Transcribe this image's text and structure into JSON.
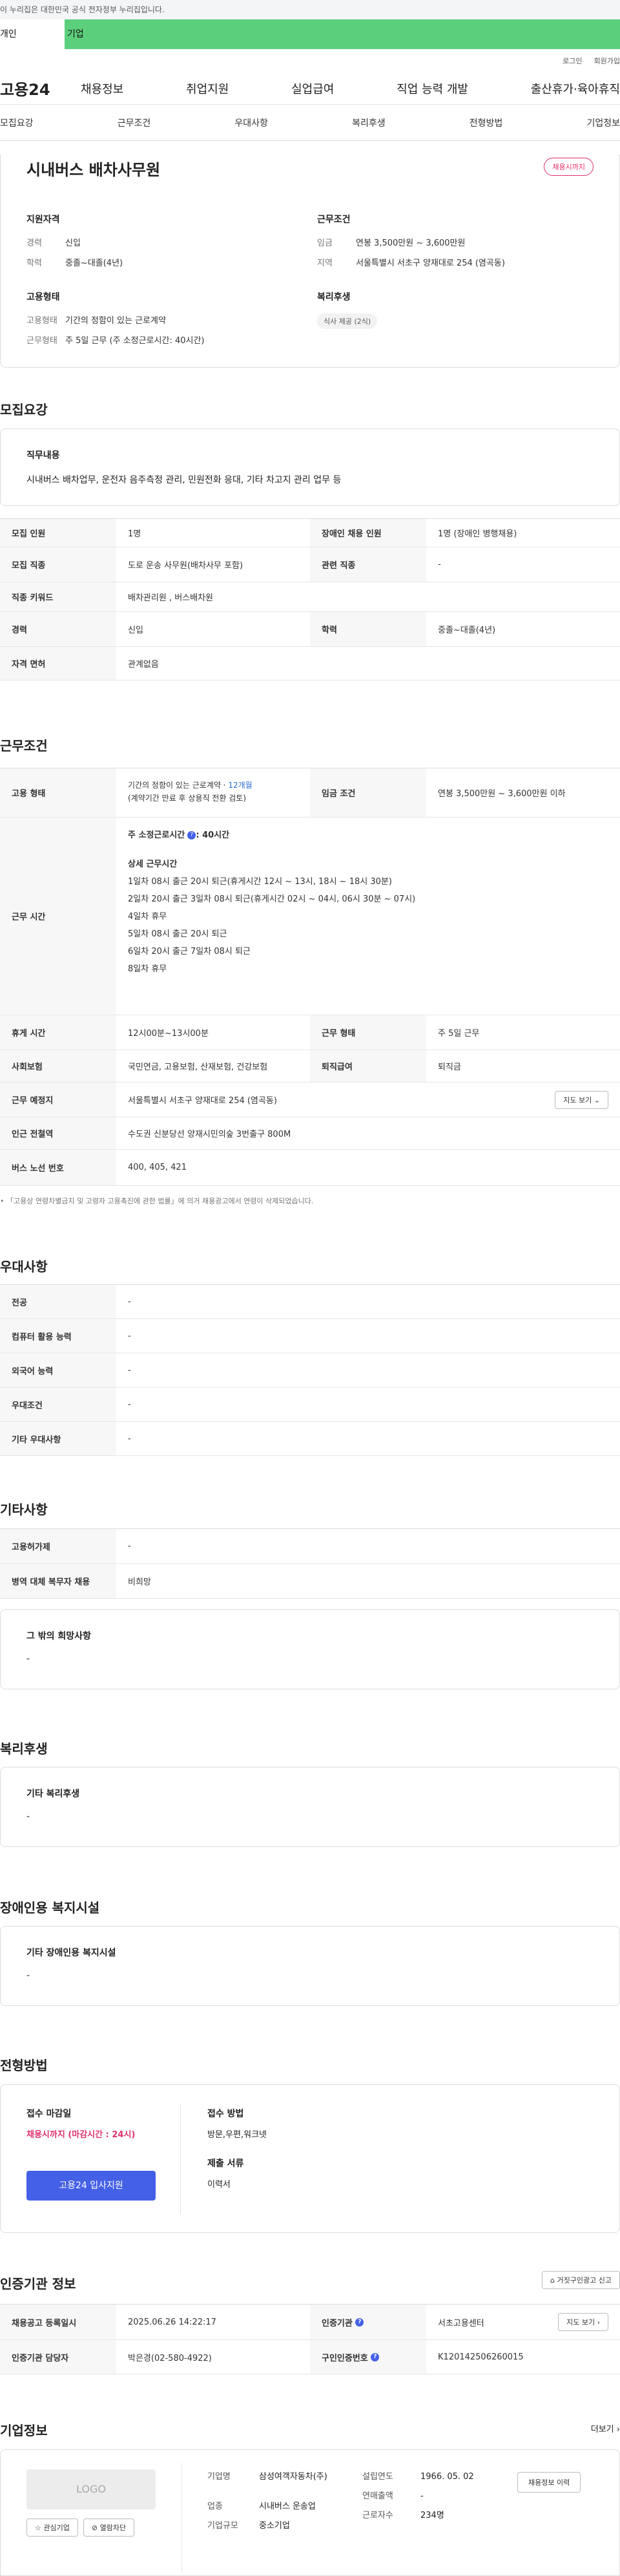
{
  "gov_banner": "이 누리집은 대한민국 공식 전자정부 누리집입니다.",
  "top_tabs": {
    "left": "개인",
    "right": "기업"
  },
  "util": {
    "login": "로그인",
    "join": "회원가입"
  },
  "logo": "고용24",
  "gnb": [
    "채용정보",
    "취업지원",
    "실업급여",
    "직업 능력 개발",
    "출산휴가·육아휴직"
  ],
  "subtabs": [
    "모집요강",
    "근무조건",
    "우대사항",
    "복리후생",
    "전형방법",
    "기업정보"
  ],
  "summary": {
    "title": "시내버스 배차사무원",
    "badge": "채용시까지",
    "qual_title": "지원자격",
    "qual": [
      {
        "k": "경력",
        "v": "신입"
      },
      {
        "k": "학력",
        "v": "중졸~대졸(4년)"
      }
    ],
    "cond_title": "근무조건",
    "cond": [
      {
        "k": "임금",
        "v": "연봉 3,500만원 ~ 3,600만원"
      },
      {
        "k": "지역",
        "v": "서울특별시 서초구 양재대로 254 (염곡동)"
      }
    ],
    "emp_title": "고용형태",
    "emp": [
      {
        "k": "고용형태",
        "v": "기간의 정함이 있는 근로계약"
      },
      {
        "k": "근무형태",
        "v": "주 5일 근무 (주 소정근로시간: 40시간)"
      }
    ],
    "welfare_title": "복리후생",
    "welfare_chip": "식사 제공 (2식)"
  },
  "recruit": {
    "title": "모집요강",
    "duty_title": "직무내용",
    "duty": "시내버스 배차업무, 운전자 음주측정 관리, 민원전화 응대, 기타 차고지 관리 업무 등",
    "rows": [
      [
        "모집 인원",
        "1명",
        "장애인 채용 인원",
        "1명 (장애인 병행채용)"
      ],
      [
        "모집 직종",
        "도로 운송 사무원(배차사무 포함)",
        "관련 직종",
        "-"
      ],
      [
        "직종 키워드",
        "배차관리원 , 버스배차원",
        "",
        ""
      ],
      [
        "경력",
        "신입",
        "학력",
        "중졸~대졸(4년)"
      ],
      [
        "자격 면허",
        "관계없음",
        "",
        ""
      ]
    ]
  },
  "work": {
    "title": "근무조건",
    "emp_type_k": "고용 형태",
    "emp_type_v1": "기간의 정함이 있는 근로계약 · ",
    "emp_type_months": "12개월",
    "emp_type_v2": "(계약기간 만료 후 상용직 전환 검토)",
    "wage_k": "임금 조건",
    "wage_v": "연봉 3,500만원 ~ 3,600만원 이하",
    "hours_k": "근무 시간",
    "hours_week": "주 소정근로시간",
    "hours_week_v": ": 40시간",
    "shift_title": "상세 근무시간",
    "shifts": [
      "1일차 08시 출근 20시 퇴근(휴게시간 12시 ~ 13시, 18시 ~ 18시 30분)",
      "2일차 20시 출근 3일차 08시 퇴근(휴게시간 02시 ~ 04시, 06시 30분 ~ 07시)",
      "4일차 휴무",
      "5일차 08시 출근 20시 퇴근",
      "6일차 20시 출근 7일차 08시 퇴근",
      "8일차 휴무"
    ],
    "rows": [
      [
        "휴게 시간",
        "12시00분~13시00분",
        "근무 형태",
        "주 5일 근무"
      ],
      [
        "사회보험",
        "국민연금, 고용보험, 산재보험, 건강보험",
        "퇴직급여",
        "퇴직금"
      ]
    ],
    "place_k": "근무 예정지",
    "place_v": "서울특별시 서초구 양재대로 254 (염곡동)",
    "map_btn": "지도 보기",
    "subway_k": "인근 전철역",
    "subway_v": "수도권 신분당선 양재시민의숲 3번출구 800M",
    "bus_k": "버스 노선 번호",
    "bus_v": "400, 405, 421",
    "note": "「고용상 연령차별금지 및 고령자 고용촉진에 관한 법률」에 의거 채용광고에서 연령이 삭제되었습니다."
  },
  "pref": {
    "title": "우대사항",
    "rows": [
      [
        "전공",
        "-"
      ],
      [
        "컴퓨터 활용 능력",
        "-"
      ],
      [
        "외국어 능력",
        "-"
      ],
      [
        "우대조건",
        "-"
      ],
      [
        "기타 우대사항",
        "-"
      ]
    ]
  },
  "etc": {
    "title": "기타사항",
    "rows": [
      [
        "고용허가제",
        "-"
      ],
      [
        "병역 대체 복무자 채용",
        "비희망"
      ]
    ],
    "other_title": "그 밖의 희망사항",
    "other_v": "-"
  },
  "welfare": {
    "title": "복리후생",
    "box_title": "기타 복리후생",
    "box_v": "-"
  },
  "disabled": {
    "title": "장애인용 복지시설",
    "box_title": "기타 장애인용 복지시설",
    "box_v": "-"
  },
  "selection": {
    "title": "전형방법",
    "deadline_title": "접수 마감일",
    "deadline_v": "채용시까지 (마감시간 : 24시)",
    "apply_btn": "고용24 입사지원",
    "method_title": "접수 방법",
    "method_v": "방문,우편,워크넷",
    "docs_title": "제출 서류",
    "docs_v": "이력서"
  },
  "agency": {
    "title": "인증기관 정보",
    "report_btn": "거짓구인광고 신고",
    "reg_k": "채용공고 등록일시",
    "reg_v": "2025.06.26 14:22:17",
    "org_k": "인증기관",
    "org_v": "서초고용센터",
    "map_btn": "지도 보기",
    "mgr_k": "인증기관 담당자",
    "mgr_v": "박은경(02-580-4922)",
    "no_k": "구인인증번호",
    "no_v": "K120142506260015"
  },
  "company": {
    "title": "기업정보",
    "more": "더보기",
    "logo_text": "LOGO",
    "fav_btn": "관심기업",
    "block_btn": "열람차단",
    "name_k": "기업명",
    "name_v": "삼성여객자동차(주)",
    "ind_k": "업종",
    "ind_v": "시내버스 운송업",
    "size_k": "기업규모",
    "size_v": "중소기업",
    "est_k": "설립연도",
    "est_v": "1966. 05. 02",
    "sales_k": "연매출액",
    "sales_v": "-",
    "emp_k": "근로자수",
    "emp_v": "234명",
    "history_btn": "채용정보 이력"
  }
}
